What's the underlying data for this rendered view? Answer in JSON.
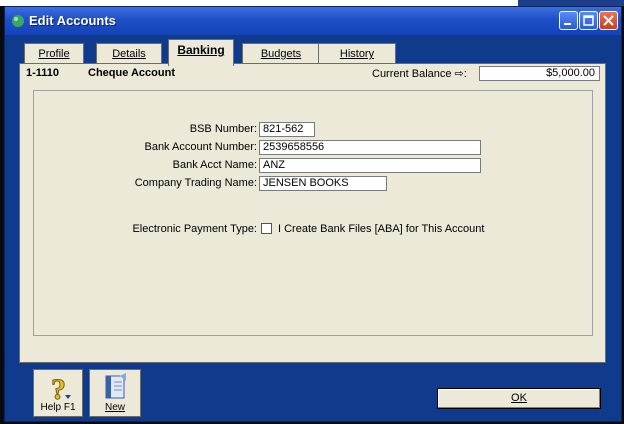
{
  "window": {
    "title": "Edit Accounts"
  },
  "tabs": [
    {
      "label": "Profile"
    },
    {
      "label": "Details"
    },
    {
      "label": "Banking"
    },
    {
      "label": "Budgets"
    },
    {
      "label": "History"
    }
  ],
  "active_tab": "Banking",
  "account": {
    "number": "1-1110",
    "name": "Cheque Account",
    "balance_label": "Current Balance ⇨:",
    "balance_value": "$5,000.00"
  },
  "banking": {
    "bsb_label": "BSB Number:",
    "bsb_value": "821-562",
    "acct_number_label": "Bank Account Number:",
    "acct_number_value": "2539658556",
    "acct_name_label": "Bank Acct Name:",
    "acct_name_value": "ANZ",
    "trading_name_label": "Company Trading Name:",
    "trading_name_value": "JENSEN BOOKS",
    "epay_label": "Electronic Payment Type:",
    "epay_checkbox_label": "I Create Bank Files [ABA] for This Account",
    "epay_checked": false
  },
  "buttons": {
    "help_label": "Help F1",
    "new_label": "New",
    "ok_label": "OK"
  },
  "colors": {
    "titlebar": "#1f4fc6",
    "window_bg": "#103a8c",
    "panel_bg": "#ece9d8"
  }
}
